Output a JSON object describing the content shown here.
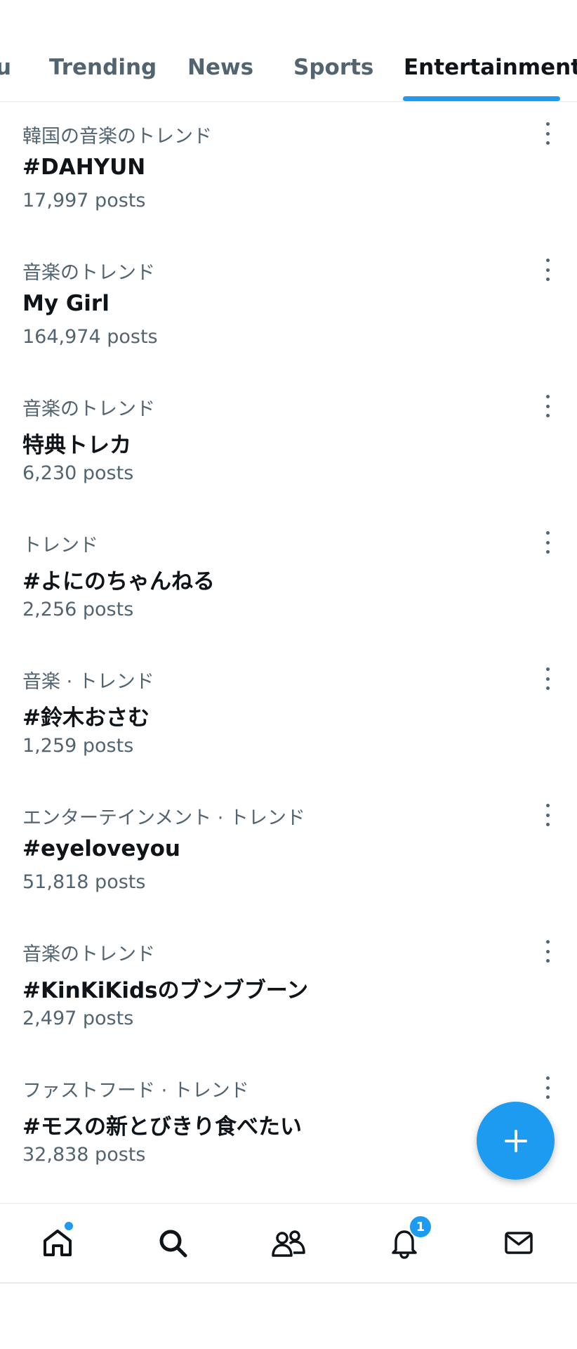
{
  "tabs": [
    {
      "label": "u",
      "active": false
    },
    {
      "label": "Trending",
      "active": false
    },
    {
      "label": "News",
      "active": false
    },
    {
      "label": "Sports",
      "active": false
    },
    {
      "label": "Entertainment",
      "active": true
    }
  ],
  "trends": [
    {
      "meta": "韓国の音楽のトレンド",
      "title": "#DAHYUN",
      "count": "17,997 posts"
    },
    {
      "meta": "音楽のトレンド",
      "title": "My Girl",
      "count": "164,974 posts"
    },
    {
      "meta": "音楽のトレンド",
      "title": "特典トレカ",
      "count": "6,230 posts"
    },
    {
      "meta": "トレンド",
      "title": "#よにのちゃんねる",
      "count": "2,256 posts"
    },
    {
      "meta": "音楽 · トレンド",
      "title": "#鈴木おさむ",
      "count": "1,259 posts"
    },
    {
      "meta": "エンターテインメント · トレンド",
      "title": "#eyeloveyou",
      "count": "51,818 posts"
    },
    {
      "meta": "音楽のトレンド",
      "title": "#KinKiKidsのブンブブーン",
      "count": "2,497 posts"
    },
    {
      "meta": "ファストフード · トレンド",
      "title": "#モスの新とびきり食べたい",
      "count": "32,838 posts"
    }
  ],
  "bottom_nav": {
    "items": [
      "home-icon",
      "search-icon",
      "communities-icon",
      "notifications-icon",
      "messages-icon"
    ],
    "notifications_badge": "1"
  },
  "fab": {
    "icon": "plus-icon"
  },
  "colors": {
    "accent": "#1d9bf0",
    "text": "#0f1419",
    "muted": "#536471",
    "divider": "#e7e9ea"
  }
}
